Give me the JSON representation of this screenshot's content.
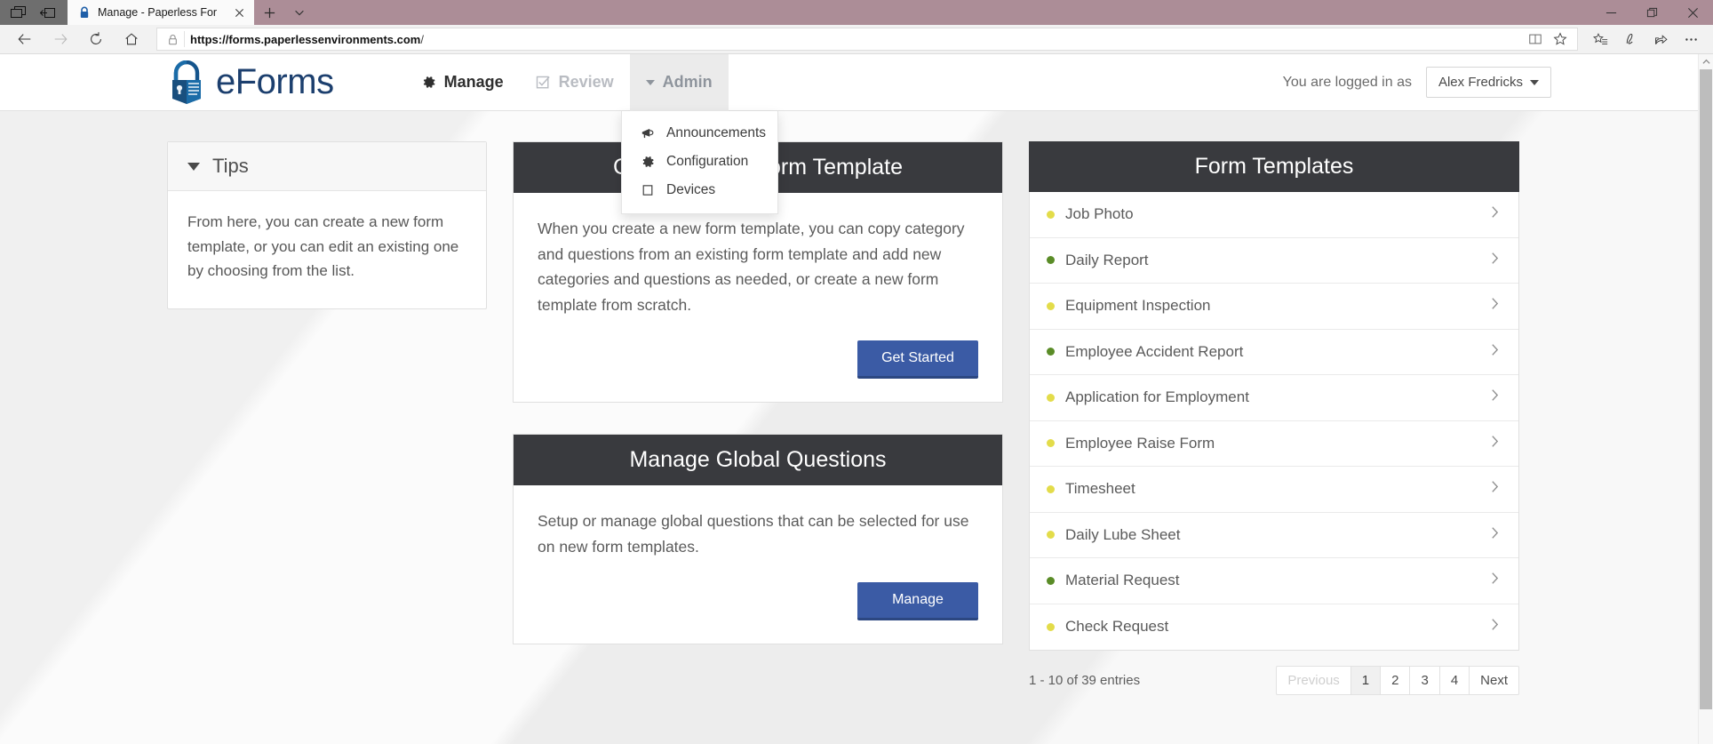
{
  "browser": {
    "tab": {
      "title": "Manage - Paperless For",
      "favicon_icon": "lock-icon",
      "close_icon": "close-icon"
    },
    "newtab_label": "+",
    "tabmenu_icon": "chevron-down-icon",
    "window_controls": {
      "minimize": "minimize-icon",
      "maximize": "restore-icon",
      "close": "close-icon"
    },
    "sysicons": {
      "taskview": "task-view-icon",
      "settings": "collapse-icon"
    },
    "toolbar": {
      "back_icon": "back-arrow-icon",
      "forward_icon": "forward-arrow-icon",
      "refresh_icon": "refresh-icon",
      "home_icon": "home-icon",
      "lock_icon": "lock-icon",
      "url_host": "https://forms.paperlessenvironments.com",
      "url_path": "/",
      "reading_view_icon": "reading-view-icon",
      "favorite_icon": "star-icon",
      "favorites_hub_icon": "favorites-hub-icon",
      "notes_icon": "notes-pen-icon",
      "share_icon": "share-icon",
      "more_icon": "more-options-icon"
    }
  },
  "app": {
    "brand": {
      "name": "eForms",
      "logo_icon": "padlock-document-icon"
    },
    "nav": [
      {
        "label": "Manage",
        "icon": "gear-icon",
        "state": "active"
      },
      {
        "label": "Review",
        "icon": "checkbox-icon",
        "state": "muted"
      },
      {
        "label": "Admin",
        "icon": "caret-down-icon",
        "state": "open"
      }
    ],
    "admin_menu": [
      {
        "label": "Announcements",
        "icon": "megaphone-icon"
      },
      {
        "label": "Configuration",
        "icon": "gear-icon"
      },
      {
        "label": "Devices",
        "icon": "tablet-icon"
      }
    ],
    "account": {
      "logged_in_text": "You are logged in as",
      "user_name": "Alex Fredricks",
      "caret_icon": "caret-down-icon"
    }
  },
  "tips": {
    "title": "Tips",
    "caret_icon": "caret-down-icon",
    "body": "From here, you can create a new form template, or you can edit an existing one by choosing from the list."
  },
  "cards": [
    {
      "title": "Create a New Form Template",
      "body": "When you create a new form template, you can copy category and questions from an existing form template and add new categories and questions as needed, or create a new form template from scratch.",
      "button": "Get Started"
    },
    {
      "title": "Manage Global Questions",
      "body": "Setup or manage global questions that can be selected for use on new form templates.",
      "button": "Manage"
    }
  ],
  "templates": {
    "title": "Form Templates",
    "chevron_icon": "chevron-right-icon",
    "status_colors": {
      "yellow": "#e3dc4a",
      "green": "#5a8c27"
    },
    "items": [
      {
        "label": "Job Photo",
        "status": "yellow"
      },
      {
        "label": "Daily Report",
        "status": "green"
      },
      {
        "label": "Equipment Inspection",
        "status": "yellow"
      },
      {
        "label": "Employee Accident Report",
        "status": "green"
      },
      {
        "label": "Application for Employment",
        "status": "yellow"
      },
      {
        "label": "Employee Raise Form",
        "status": "yellow"
      },
      {
        "label": "Timesheet",
        "status": "yellow"
      },
      {
        "label": "Daily Lube Sheet",
        "status": "yellow"
      },
      {
        "label": "Material Request",
        "status": "green"
      },
      {
        "label": "Check Request",
        "status": "yellow"
      }
    ]
  },
  "pagination": {
    "info": "1 - 10 of 39 entries",
    "previous": "Previous",
    "next": "Next",
    "pages": [
      "1",
      "2",
      "3",
      "4"
    ],
    "active_page": "1"
  },
  "theme": {
    "accent_blue": "#3b5ba5",
    "header_dark": "#393a3e",
    "brand_blue": "#1c3f6e",
    "titlebar": "#ac8d97"
  }
}
